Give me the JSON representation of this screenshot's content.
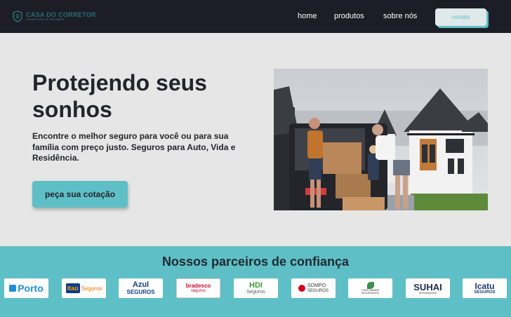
{
  "nav": {
    "brand": "CASA DO CORRETOR",
    "brand_sub": "CORRETORA DE SEGUROS",
    "links": [
      "home",
      "produtos",
      "sobre nós"
    ],
    "contact_label": "contato",
    "icon": "shield-icon"
  },
  "hero": {
    "title": "Protejendo seus sonhos",
    "description": "Encontre o melhor seguro para você ou para sua família com preço justo. Seguros para Auto, Vida e Residência.",
    "cta_label": "peça sua cotação",
    "photo": "family-moving-photo"
  },
  "partners": {
    "title": "Nossos parceiros de confiança",
    "logos": [
      {
        "name": "Porto",
        "text": "Porto"
      },
      {
        "name": "Itaú Seguros",
        "text": "Itaú",
        "sub": "Seguros"
      },
      {
        "name": "Azul Seguros",
        "text": "Azul",
        "sub": "SEGUROS"
      },
      {
        "name": "Bradesco Seguros",
        "text": "bradesco",
        "sub": "seguros"
      },
      {
        "name": "HDI Seguros",
        "text": "HDI",
        "sub": "Seguros"
      },
      {
        "name": "Sompo Seguros",
        "text": "SOMPO",
        "sub": "SEGUROS"
      },
      {
        "name": "Tokio Marine",
        "text": "TOKIO MARINE",
        "sub": "SEGURADORA"
      },
      {
        "name": "Suhai",
        "text": "SUHAI",
        "sub": "SEGURADORA"
      },
      {
        "name": "Icatu Seguros",
        "text": "Icatu",
        "sub": "SEGUROS"
      }
    ]
  },
  "colors": {
    "nav_bg": "#1c1d26",
    "accent": "#5fbfc6",
    "page_bg": "#e6e6e6",
    "text_dark": "#23242c"
  }
}
